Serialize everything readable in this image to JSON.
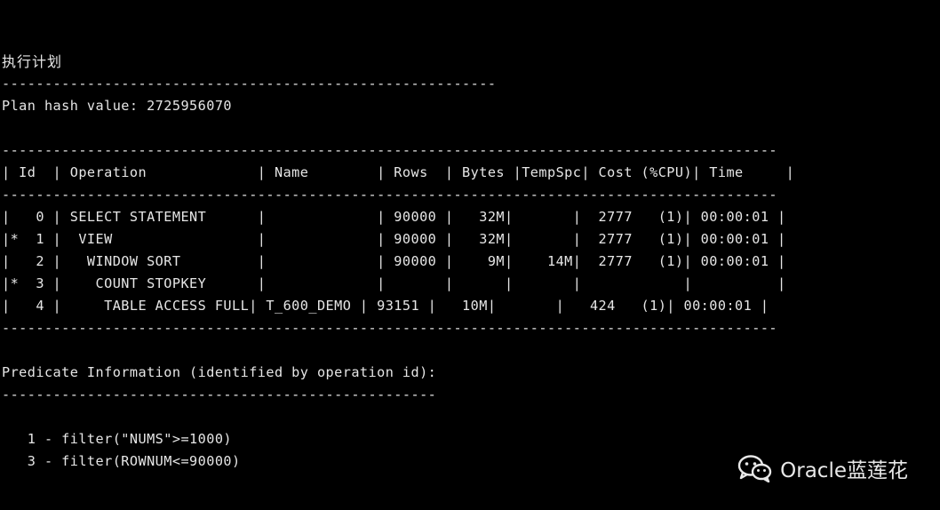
{
  "title": "执行计划",
  "separator_1": "----------------------------------------------------------",
  "plan_hash_line": "Plan hash value: 2725956070",
  "table_rule": "-------------------------------------------------------------------------------------------",
  "table_header": "| Id  | Operation             | Name        | Rows  | Bytes |TempSpc| Cost (%CPU)| Time     |",
  "table_rows": [
    "|   0 | SELECT STATEMENT      |             | 90000 |   32M|       |  2777   (1)| 00:00:01 |",
    "|*  1 |  VIEW                 |             | 90000 |   32M|       |  2777   (1)| 00:00:01 |",
    "|   2 |   WINDOW SORT         |             | 90000 |    9M|    14M|  2777   (1)| 00:00:01 |",
    "|*  3 |    COUNT STOPKEY      |             |       |      |       |            |          |",
    "|   4 |     TABLE ACCESS FULL| T_600_DEMO | 93151 |   10M|       |   424   (1)| 00:00:01 |"
  ],
  "predicate_heading": "Predicate Information (identified by operation id):",
  "separator_2": "---------------------------------------------------",
  "predicates": [
    "   1 - filter(\"NUMS\">=1000)",
    "   3 - filter(ROWNUM<=90000)"
  ],
  "watermark": {
    "text": "Oracle蓝莲花",
    "icon": "wechat-icon"
  },
  "colors": {
    "background": "#000000",
    "text": "#e6e6e6"
  }
}
